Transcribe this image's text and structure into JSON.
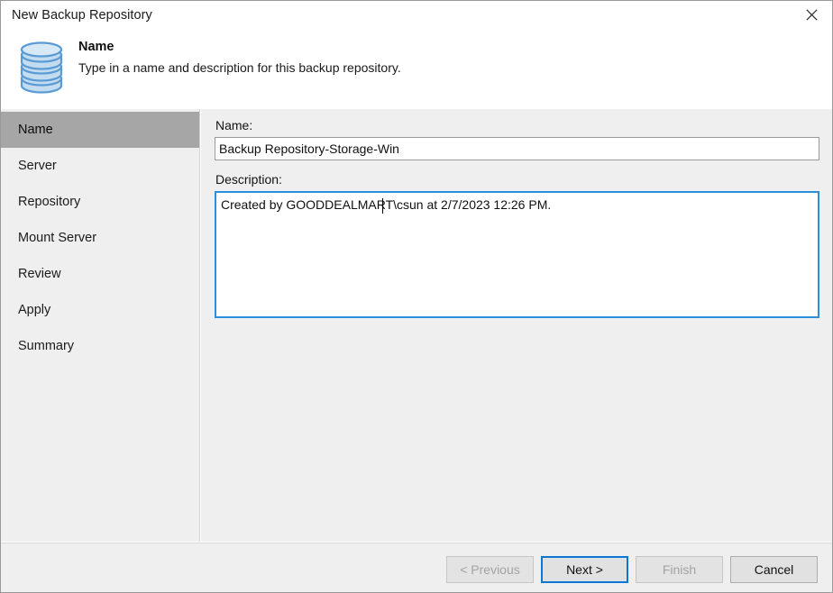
{
  "window": {
    "title": "New Backup Repository",
    "close_icon": "close-icon"
  },
  "header": {
    "icon": "database-repository-icon",
    "title": "Name",
    "subtitle": "Type in a name and description for this backup repository."
  },
  "sidebar": {
    "items": [
      {
        "label": "Name",
        "selected": true
      },
      {
        "label": "Server",
        "selected": false
      },
      {
        "label": "Repository",
        "selected": false
      },
      {
        "label": "Mount Server",
        "selected": false
      },
      {
        "label": "Review",
        "selected": false
      },
      {
        "label": "Apply",
        "selected": false
      },
      {
        "label": "Summary",
        "selected": false
      }
    ]
  },
  "form": {
    "name_label": "Name:",
    "name_value": "Backup Repository-Storage-Win",
    "name_placeholder": "",
    "description_label": "Description:",
    "description_value": "Created by GOODDEALMART\\csun at 2/7/2023 12:26 PM.",
    "description_placeholder": ""
  },
  "footer": {
    "previous_label": "< Previous",
    "next_label": "Next >",
    "finish_label": "Finish",
    "cancel_label": "Cancel"
  },
  "colors": {
    "accent_blue": "#0a78d4",
    "focus_border": "#2b8fdd",
    "sidebar_background": "#efefef",
    "selected_item": "#a6a6a6",
    "icon_fill": "#bcd9ef",
    "icon_stroke": "#5b9bd5"
  }
}
